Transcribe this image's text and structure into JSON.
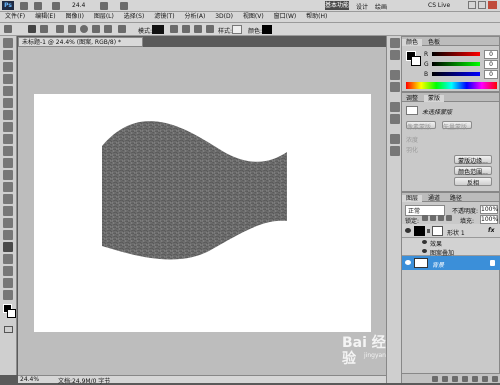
{
  "app": {
    "logo": "Ps",
    "zoom_value": "24.4",
    "mode_button": "基本功能",
    "workspace_buttons": [
      "设计",
      "绘画"
    ],
    "cs_live": "CS Live"
  },
  "menu": [
    "文件(F)",
    "编辑(E)",
    "图像(I)",
    "图层(L)",
    "选择(S)",
    "滤镜(T)",
    "分析(A)",
    "3D(D)",
    "视图(V)",
    "窗口(W)",
    "帮助(H)"
  ],
  "options_bar": {
    "mode_label": "模式:",
    "style_label": "样式:",
    "color_label": "颜色:"
  },
  "document_tab": {
    "title": "未标题-1 @ 24.4% (图案, RGB/8) *"
  },
  "status": {
    "zoom": "24.4%",
    "doc_info": "文档:24.9M/0 字节"
  },
  "color_panel": {
    "tabs": [
      "颜色",
      "色板"
    ],
    "r_label": "R",
    "g_label": "G",
    "b_label": "B",
    "r_value": "0",
    "g_value": "0",
    "b_value": "0"
  },
  "adjust_panel": {
    "tabs": [
      "调整",
      "蒙版"
    ],
    "title": "未选择蒙版",
    "buttons": [
      "像素蒙版",
      "矢量蒙版",
      "浓度",
      "羽化",
      "蒙版边缘...",
      "颜色范围...",
      "反相"
    ]
  },
  "layers_panel": {
    "tabs": [
      "图层",
      "通道",
      "路径"
    ],
    "blend_mode": "正常",
    "opacity_label": "不透明度:",
    "opacity_value": "100%",
    "lock_label": "锁定:",
    "fill_label": "填充:",
    "fill_value": "100%",
    "layers": [
      {
        "name": "形状 1",
        "effects_label": "效果",
        "effect": "图案叠加"
      },
      {
        "name": "背景"
      }
    ]
  },
  "watermark": {
    "text": "Bai 经验",
    "url": "jingyan.baidu.com"
  },
  "colors": {
    "selection_blue": "#3b8fd9",
    "canvas_bg": "#bdbdbd",
    "panel": "#c9c9c9"
  }
}
